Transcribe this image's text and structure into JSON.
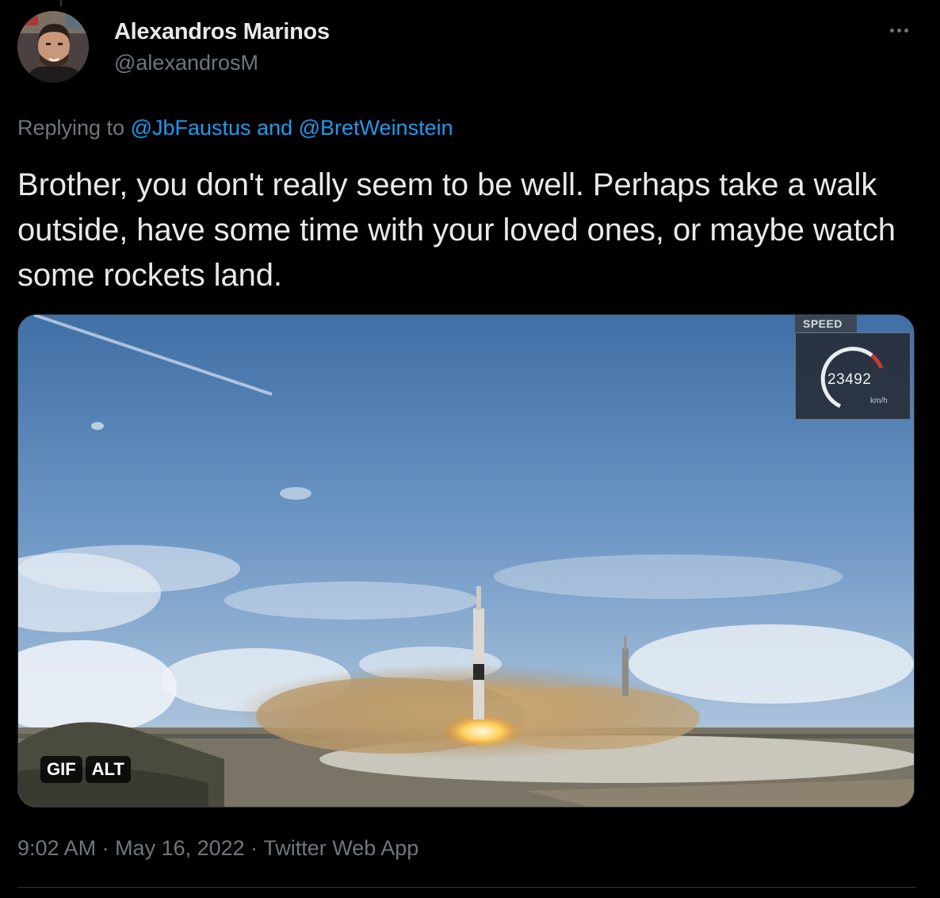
{
  "author": {
    "display_name": "Alexandros Marinos",
    "handle": "@alexandrosM"
  },
  "reply": {
    "prefix": "Replying to ",
    "mention_1": "@JbFaustus",
    "connector": " and ",
    "mention_2": "@BretWeinstein"
  },
  "tweet": {
    "text": "Brother, you don't really seem to be well. Perhaps take a walk outside, have some time with your loved ones, or maybe watch some rockets land."
  },
  "media": {
    "type": "gif",
    "overlay": {
      "speed_label": "SPEED",
      "speed_value": "23492",
      "speed_unit": "km/h"
    },
    "badges": {
      "gif": "GIF",
      "alt": "ALT"
    }
  },
  "meta": {
    "time": "9:02 AM",
    "sep_1": " · ",
    "date": "May 16, 2022",
    "sep_2": " · ",
    "source": "Twitter Web App"
  },
  "icons": {
    "more": "more-horizontal-icon"
  },
  "colors": {
    "background": "#000000",
    "text_primary": "#e7e9ea",
    "text_secondary": "#71767b",
    "link": "#1d9bf0",
    "divider": "#2f3336"
  }
}
